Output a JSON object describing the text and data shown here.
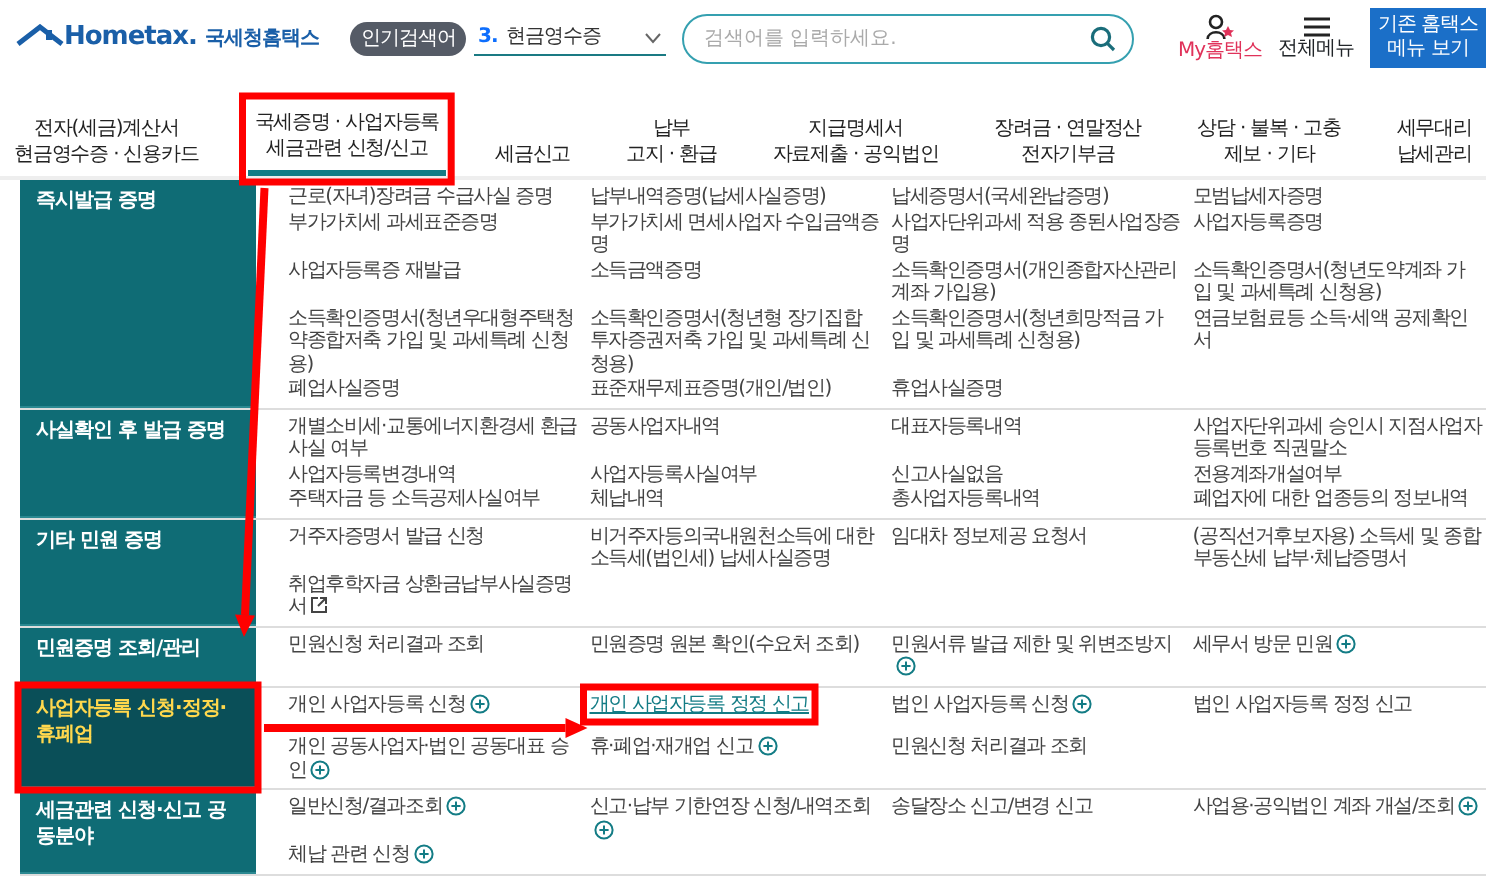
{
  "header": {
    "logo_text": "Hometax.",
    "logo_subtitle": "국세청홈택스",
    "popular_label": "인기검색어",
    "popular_rank": "3.",
    "popular_term": "현금영수증",
    "search": {
      "placeholder": "검색어를 입력하세요."
    },
    "my_label": "My홈택스",
    "menu_label": "전체메뉴",
    "classic_button": "기존 홈택스 메뉴 보기"
  },
  "nav": [
    {
      "lines": [
        "전자(세금)계산서",
        "현금영수증 · 신용카드"
      ],
      "selected": false,
      "boxed": false
    },
    {
      "lines": [
        "국세증명 · 사업자등록",
        "세금관련 신청/신고"
      ],
      "selected": true,
      "boxed": true
    },
    {
      "lines": [
        "세금신고"
      ],
      "selected": false,
      "boxed": false
    },
    {
      "lines": [
        "납부",
        "고지 · 환급"
      ],
      "selected": false,
      "boxed": false
    },
    {
      "lines": [
        "지급명세서",
        "자료제출 · 공익법인"
      ],
      "selected": false,
      "boxed": false
    },
    {
      "lines": [
        "장려금 · 연말정산",
        "전자기부금"
      ],
      "selected": false,
      "boxed": false
    },
    {
      "lines": [
        "상담 · 불복 · 고충",
        "제보 · 기타"
      ],
      "selected": false,
      "boxed": false
    },
    {
      "lines": [
        "세무대리",
        "납세관리"
      ],
      "selected": false,
      "boxed": false
    }
  ],
  "sections": [
    {
      "title": "즉시발급 증명",
      "selected": false,
      "boxed": false,
      "items": [
        {
          "text": "근로(자녀)장려금 수급사실 증명"
        },
        {
          "text": "납부내역증명(납세사실증명)"
        },
        {
          "text": "납세증명서(국세완납증명)"
        },
        {
          "text": "모범납세자증명"
        },
        {
          "text": "부가가치세 과세표준증명"
        },
        {
          "text": "부가가치세 면세사업자 수입금액증명"
        },
        {
          "text": "사업자단위과세 적용 종된사업장증명"
        },
        {
          "text": "사업자등록증명"
        },
        {
          "text": "사업자등록증 재발급"
        },
        {
          "text": "소득금액증명"
        },
        {
          "text": "소득확인증명서(개인종합자산관리계좌 가입용)"
        },
        {
          "text": "소득확인증명서(청년도약계좌 가입 및 과세특례 신청용)"
        },
        {
          "text": "소득확인증명서(청년우대형주택청약종합저축 가입 및 과세특례 신청용)"
        },
        {
          "text": "소득확인증명서(청년형 장기집합투자증권저축 가입 및 과세특례 신청용)"
        },
        {
          "text": "소득확인증명서(청년희망적금 가입 및 과세특례 신청용)"
        },
        {
          "text": "연금보험료등 소득·세액 공제확인서"
        },
        {
          "text": "폐업사실증명"
        },
        {
          "text": "표준재무제표증명(개인/법인)"
        },
        {
          "text": "휴업사실증명"
        }
      ]
    },
    {
      "title": "사실확인 후 발급 증명",
      "selected": false,
      "boxed": false,
      "items": [
        {
          "text": "개별소비세·교통에너지환경세 환급사실 여부"
        },
        {
          "text": "공동사업자내역"
        },
        {
          "text": "대표자등록내역"
        },
        {
          "text": "사업자단위과세 승인시 지점사업자등록번호 직권말소"
        },
        {
          "text": "사업자등록변경내역"
        },
        {
          "text": "사업자등록사실여부"
        },
        {
          "text": "신고사실없음"
        },
        {
          "text": "전용계좌개설여부"
        },
        {
          "text": "주택자금 등 소득공제사실여부"
        },
        {
          "text": "체납내역"
        },
        {
          "text": "총사업자등록내역"
        },
        {
          "text": "폐업자에 대한 업종등의 정보내역"
        }
      ]
    },
    {
      "title": "기타 민원 증명",
      "selected": false,
      "boxed": false,
      "items": [
        {
          "text": "거주자증명서 발급 신청"
        },
        {
          "text": "비거주자등의국내원천소득에 대한 소득세(법인세) 납세사실증명"
        },
        {
          "text": "임대차 정보제공 요청서"
        },
        {
          "text": "(공직선거후보자용) 소득세 및 종합부동산세 납부·체납증명서"
        },
        {
          "text": "취업후학자금 상환금납부사실증명서",
          "external": true
        }
      ]
    },
    {
      "title": "민원증명 조회/관리",
      "selected": false,
      "boxed": false,
      "items": [
        {
          "text": "민원신청 처리결과 조회"
        },
        {
          "text": "민원증명 원본 확인(수요처 조회)"
        },
        {
          "text": "민원서류 발급 제한 및 위변조방지",
          "plus": true
        },
        {
          "text": "세무서 방문 민원",
          "plus": true
        }
      ]
    },
    {
      "title": "사업자등록 신청·정정·휴폐업",
      "selected": true,
      "boxed": true,
      "items": [
        {
          "text": "개인 사업자등록 신청",
          "plus": true
        },
        {
          "text": "개인 사업자등록 정정 신고",
          "boxed": true
        },
        {
          "text": "법인 사업자등록 신청",
          "plus": true
        },
        {
          "text": "법인 사업자등록 정정 신고"
        },
        {
          "text": "개인 공동사업자·법인 공동대표 승인",
          "plus": true
        },
        {
          "text": "휴·폐업·재개업 신고",
          "plus": true
        },
        {
          "text": "민원신청 처리결과 조회"
        }
      ]
    },
    {
      "title": "세금관련 신청·신고 공동분야",
      "selected": false,
      "boxed": false,
      "items": [
        {
          "text": "일반신청/결과조회",
          "plus": true
        },
        {
          "text": "신고·납부 기한연장 신청/내역조회",
          "plus": true
        },
        {
          "text": "송달장소 신고/변경 신고"
        },
        {
          "text": "사업용·공익법인 계좌 개설/조회",
          "plus": true
        },
        {
          "text": "체납 관련 신청",
          "plus": true
        }
      ]
    }
  ]
}
